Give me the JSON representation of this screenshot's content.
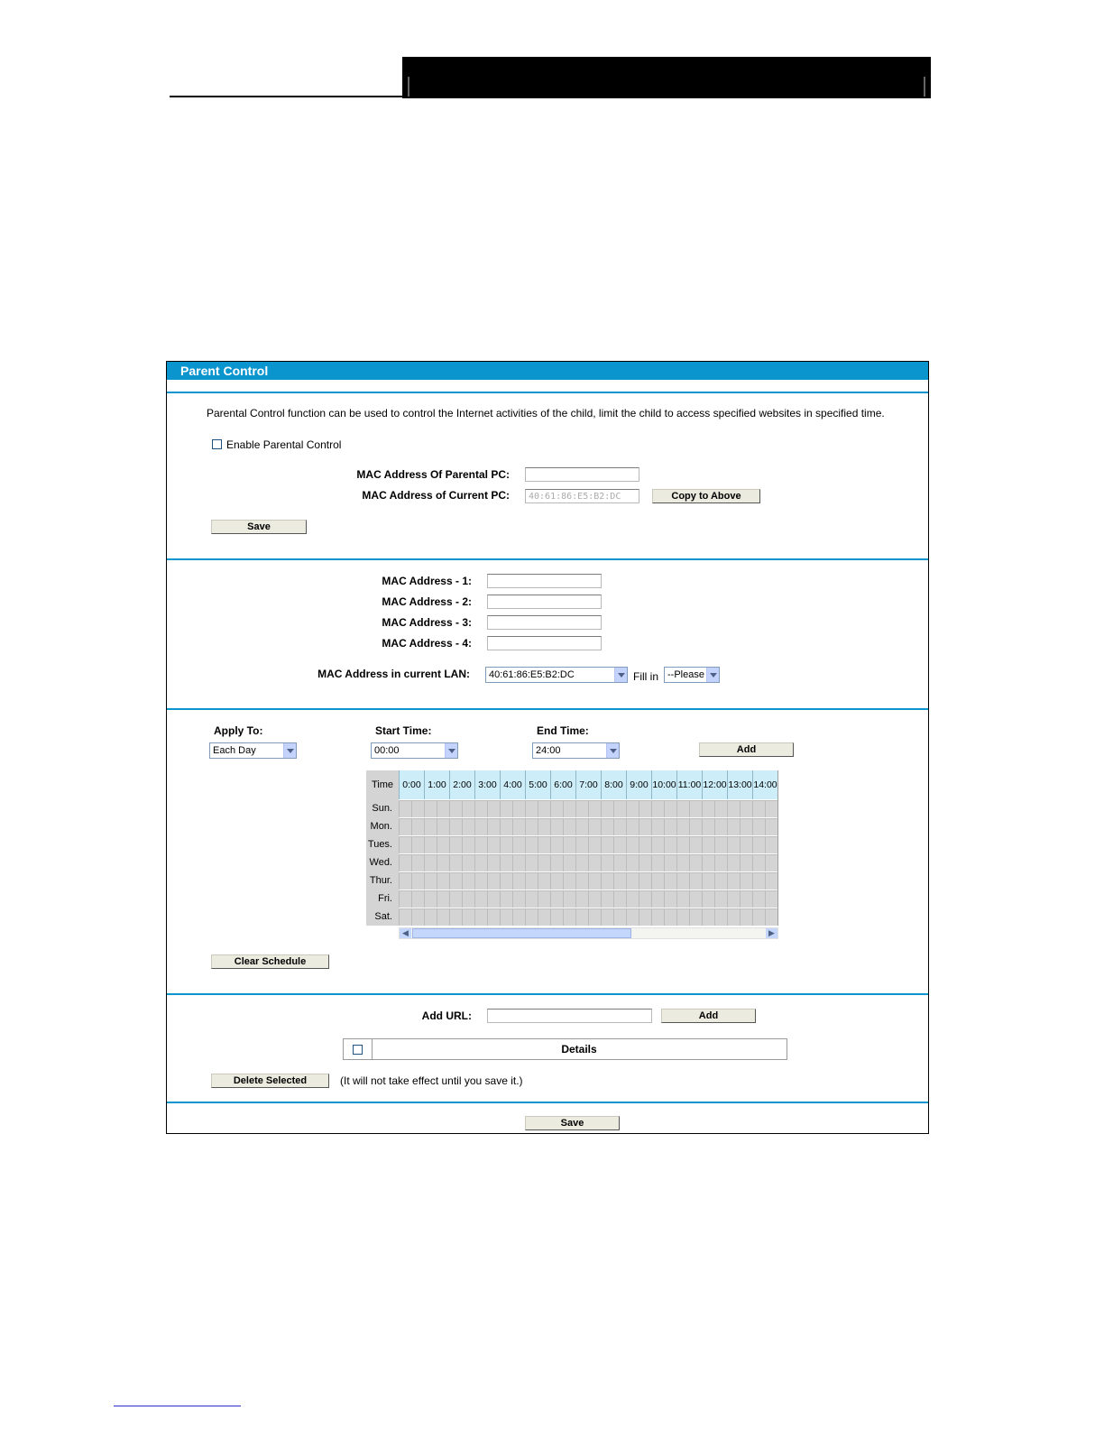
{
  "panel": {
    "title": "Parent Control",
    "description": "Parental Control function can be used to control the Internet activities of the child, limit the child to access specified websites in specified time.",
    "enable_label": "Enable Parental Control",
    "enable_checked": false,
    "parental_pc_label": "MAC Address Of Parental PC:",
    "parental_pc_value": "",
    "current_pc_label": "MAC Address of Current PC:",
    "current_pc_value": "40:61:86:E5:B2:DC",
    "copy_button": "Copy to Above",
    "save_button": "Save"
  },
  "children": {
    "mac_fields": [
      {
        "label": "MAC Address - 1:",
        "value": ""
      },
      {
        "label": "MAC Address - 2:",
        "value": ""
      },
      {
        "label": "MAC Address - 3:",
        "value": ""
      },
      {
        "label": "MAC Address - 4:",
        "value": ""
      }
    ],
    "lan_label": "MAC Address in current LAN:",
    "lan_selected": "40:61:86:E5:B2:DC",
    "fill_in_label": "Fill in",
    "fill_in_selected": "--Please"
  },
  "schedule": {
    "apply_to_label": "Apply To:",
    "apply_to_selected": "Each Day",
    "start_label": "Start Time:",
    "start_selected": "00:00",
    "end_label": "End Time:",
    "end_selected": "24:00",
    "add_button": "Add",
    "time_header": "Time",
    "hours": [
      "0:00",
      "1:00",
      "2:00",
      "3:00",
      "4:00",
      "5:00",
      "6:00",
      "7:00",
      "8:00",
      "9:00",
      "10:00",
      "11:00",
      "12:00",
      "13:00",
      "14:00"
    ],
    "days": [
      "Sun.",
      "Mon.",
      "Tues.",
      "Wed.",
      "Thur.",
      "Fri.",
      "Sat."
    ],
    "clear_button": "Clear Schedule"
  },
  "url": {
    "add_url_label": "Add URL:",
    "add_url_value": "",
    "add_button": "Add",
    "table_header": "Details",
    "delete_button": "Delete Selected",
    "note": "(It will not take effect until you save it.)"
  },
  "footer": {
    "save_button": "Save"
  }
}
